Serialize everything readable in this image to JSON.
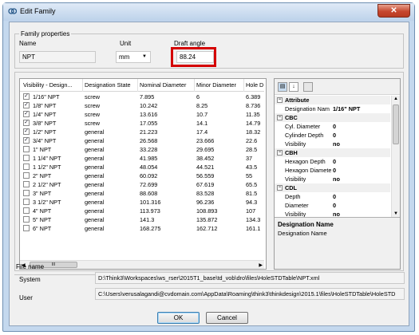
{
  "window": {
    "title": "Edit Family",
    "close_glyph": "✕"
  },
  "family": {
    "section_label": "Family properties",
    "name_label": "Name",
    "name_value": "NPT",
    "unit_label": "Unit",
    "unit_value": "mm",
    "draft_label": "Draft angle",
    "draft_value": "88.24"
  },
  "table": {
    "columns": [
      "Visibility - Design...",
      "Designation State",
      "Nominal Diameter",
      "Minor Diameter",
      "Hole D"
    ],
    "rows": [
      {
        "checked": true,
        "name": "1/16\" NPT",
        "state": "screw",
        "nominal": "7.895",
        "minor": "6",
        "hole": "6.389"
      },
      {
        "checked": true,
        "name": "1/8\" NPT",
        "state": "screw",
        "nominal": "10.242",
        "minor": "8.25",
        "hole": "8.736"
      },
      {
        "checked": true,
        "name": "1/4\" NPT",
        "state": "screw",
        "nominal": "13.616",
        "minor": "10.7",
        "hole": "11.35"
      },
      {
        "checked": true,
        "name": "3/8\" NPT",
        "state": "screw",
        "nominal": "17.055",
        "minor": "14.1",
        "hole": "14.79"
      },
      {
        "checked": true,
        "name": "1/2\" NPT",
        "state": "general",
        "nominal": "21.223",
        "minor": "17.4",
        "hole": "18.32"
      },
      {
        "checked": true,
        "name": "3/4\" NPT",
        "state": "general",
        "nominal": "26.568",
        "minor": "23.666",
        "hole": "22.6"
      },
      {
        "checked": false,
        "name": "1\" NPT",
        "state": "general",
        "nominal": "33.228",
        "minor": "29.695",
        "hole": "28.5"
      },
      {
        "checked": false,
        "name": "1 1/4\" NPT",
        "state": "general",
        "nominal": "41.985",
        "minor": "38.452",
        "hole": "37"
      },
      {
        "checked": false,
        "name": "1 1/2\" NPT",
        "state": "general",
        "nominal": "48.054",
        "minor": "44.521",
        "hole": "43.5"
      },
      {
        "checked": false,
        "name": "2\" NPT",
        "state": "general",
        "nominal": "60.092",
        "minor": "56.559",
        "hole": "55"
      },
      {
        "checked": false,
        "name": "2 1/2\" NPT",
        "state": "general",
        "nominal": "72.699",
        "minor": "67.619",
        "hole": "65.5"
      },
      {
        "checked": false,
        "name": "3\" NPT",
        "state": "general",
        "nominal": "88.608",
        "minor": "83.528",
        "hole": "81.5"
      },
      {
        "checked": false,
        "name": "3 1/2\" NPT",
        "state": "general",
        "nominal": "101.316",
        "minor": "96.236",
        "hole": "94.3"
      },
      {
        "checked": false,
        "name": "4\" NPT",
        "state": "general",
        "nominal": "113.973",
        "minor": "108.893",
        "hole": "107"
      },
      {
        "checked": false,
        "name": "5\" NPT",
        "state": "general",
        "nominal": "141.3",
        "minor": "135.872",
        "hole": "134.3"
      },
      {
        "checked": false,
        "name": "6\" NPT",
        "state": "general",
        "nominal": "168.275",
        "minor": "162.712",
        "hole": "161.1"
      }
    ],
    "scroll_thumb": "III"
  },
  "properties": {
    "rows": [
      {
        "type": "cat",
        "name": "Attribute"
      },
      {
        "type": "prop",
        "name": "Designation Nam",
        "value": "1/16\" NPT"
      },
      {
        "type": "cat",
        "name": "CBC"
      },
      {
        "type": "prop",
        "name": "Cyl. Diameter",
        "value": "0"
      },
      {
        "type": "prop",
        "name": "Cylinder Depth",
        "value": "0"
      },
      {
        "type": "prop",
        "name": "Visibility",
        "value": "no"
      },
      {
        "type": "cat",
        "name": "CBH"
      },
      {
        "type": "prop",
        "name": "Hexagon Depth",
        "value": "0"
      },
      {
        "type": "prop",
        "name": "Hexagon Diamete",
        "value": "0"
      },
      {
        "type": "prop",
        "name": "Visibility",
        "value": "no"
      },
      {
        "type": "cat",
        "name": "CDL"
      },
      {
        "type": "prop",
        "name": "Depth",
        "value": "0"
      },
      {
        "type": "prop",
        "name": "Diameter",
        "value": "0"
      },
      {
        "type": "prop",
        "name": "Visibility",
        "value": "no"
      }
    ],
    "desc_title": "Designation Name",
    "desc_text": "Designation Name"
  },
  "files": {
    "section_label": "File name",
    "system_label": "System",
    "system_path": "D:\\Think3\\Workspaces\\ws_rser\\2015T1_base\\td_vob\\dro\\files\\HoleSTDTable\\NPT.xml",
    "user_label": "User",
    "user_path": "C:\\Users\\verusalagandi@cvdomain.com\\AppData\\Roaming\\think3\\thinkdesign\\2015.1\\files\\HoleSTDTable\\HoleSTD"
  },
  "buttons": {
    "ok": "OK",
    "cancel": "Cancel"
  },
  "colors": {
    "highlight": "#d40000",
    "window_border": "#6f8fb2",
    "close": "#c6472e"
  }
}
